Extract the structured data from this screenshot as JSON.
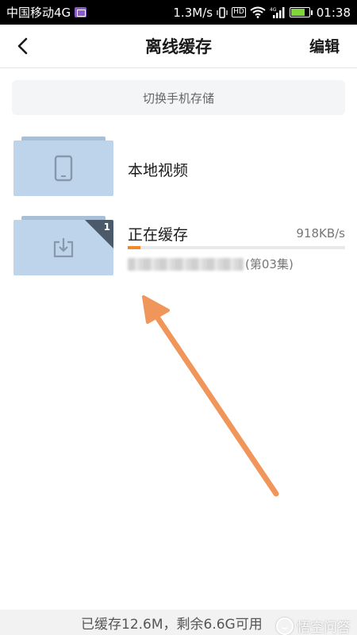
{
  "status_bar": {
    "carrier": "中国移动4G",
    "speed": "1.3M/s",
    "network": "4G",
    "time": "01:38"
  },
  "header": {
    "title": "离线缓存",
    "edit_label": "编辑"
  },
  "switch_storage_label": "切换手机存储",
  "local_video": {
    "label": "本地视频",
    "icon": "phone-icon"
  },
  "caching": {
    "label": "正在缓存",
    "speed": "918KB/s",
    "episode": "(第03集)",
    "badge_count": "1",
    "progress_percent": 6,
    "icon": "download-icon"
  },
  "footer": {
    "storage_text": "已缓存12.6M，剩余6.6G可用",
    "watermark": "悟空问答"
  },
  "colors": {
    "accent": "#f28a2a",
    "folder": "#bed4ea",
    "badge": "#4b5a6b",
    "annotation_arrow": "#f0965a"
  }
}
